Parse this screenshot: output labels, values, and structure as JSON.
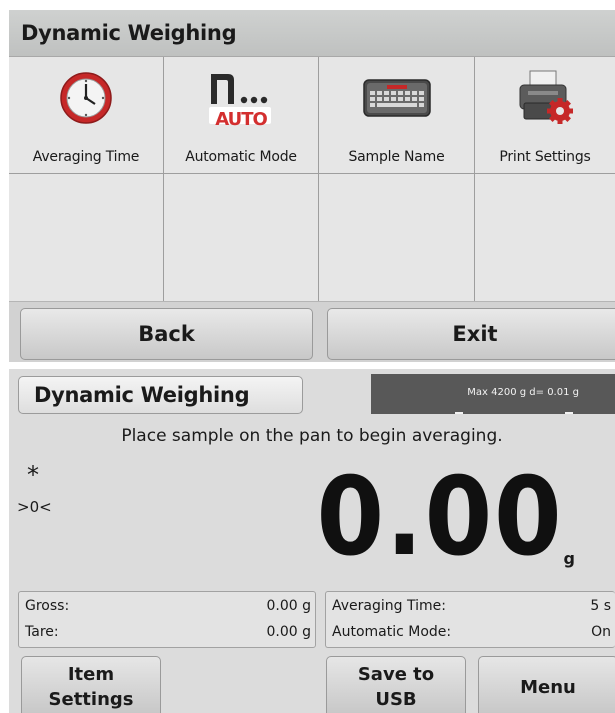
{
  "top_screen": {
    "title": "Dynamic Weighing",
    "items": [
      {
        "label": "Averaging Time",
        "icon": "clock-icon"
      },
      {
        "label": "Automatic Mode",
        "icon": "auto-mode-icon",
        "icon_text": "AUTO"
      },
      {
        "label": "Sample Name",
        "icon": "keyboard-icon"
      },
      {
        "label": "Print Settings",
        "icon": "printer-settings-icon"
      }
    ],
    "buttons": {
      "back": "Back",
      "exit": "Exit"
    }
  },
  "bottom_screen": {
    "title": "Dynamic Weighing",
    "capacity": "Max 4200 g  d= 0.01 g",
    "message": "Place sample on the pan to begin averaging.",
    "stable_indicator": "*",
    "zero_indicator": ">0<",
    "weight": "0.00",
    "unit": "g",
    "left_info": [
      {
        "label": "Gross:",
        "value": "0.00 g"
      },
      {
        "label": "Tare:",
        "value": "0.00 g"
      }
    ],
    "right_info": [
      {
        "label": "Averaging Time:",
        "value": "5 s"
      },
      {
        "label": "Automatic Mode:",
        "value": "On"
      }
    ],
    "buttons": {
      "item_settings_line1": "Item",
      "item_settings_line2": "Settings",
      "save_usb_line1": "Save to",
      "save_usb_line2": "USB",
      "menu": "Menu"
    }
  },
  "colors": {
    "clock_red": "#c62828",
    "auto_red": "#d32f2f",
    "capacity_bg": "#585858"
  }
}
